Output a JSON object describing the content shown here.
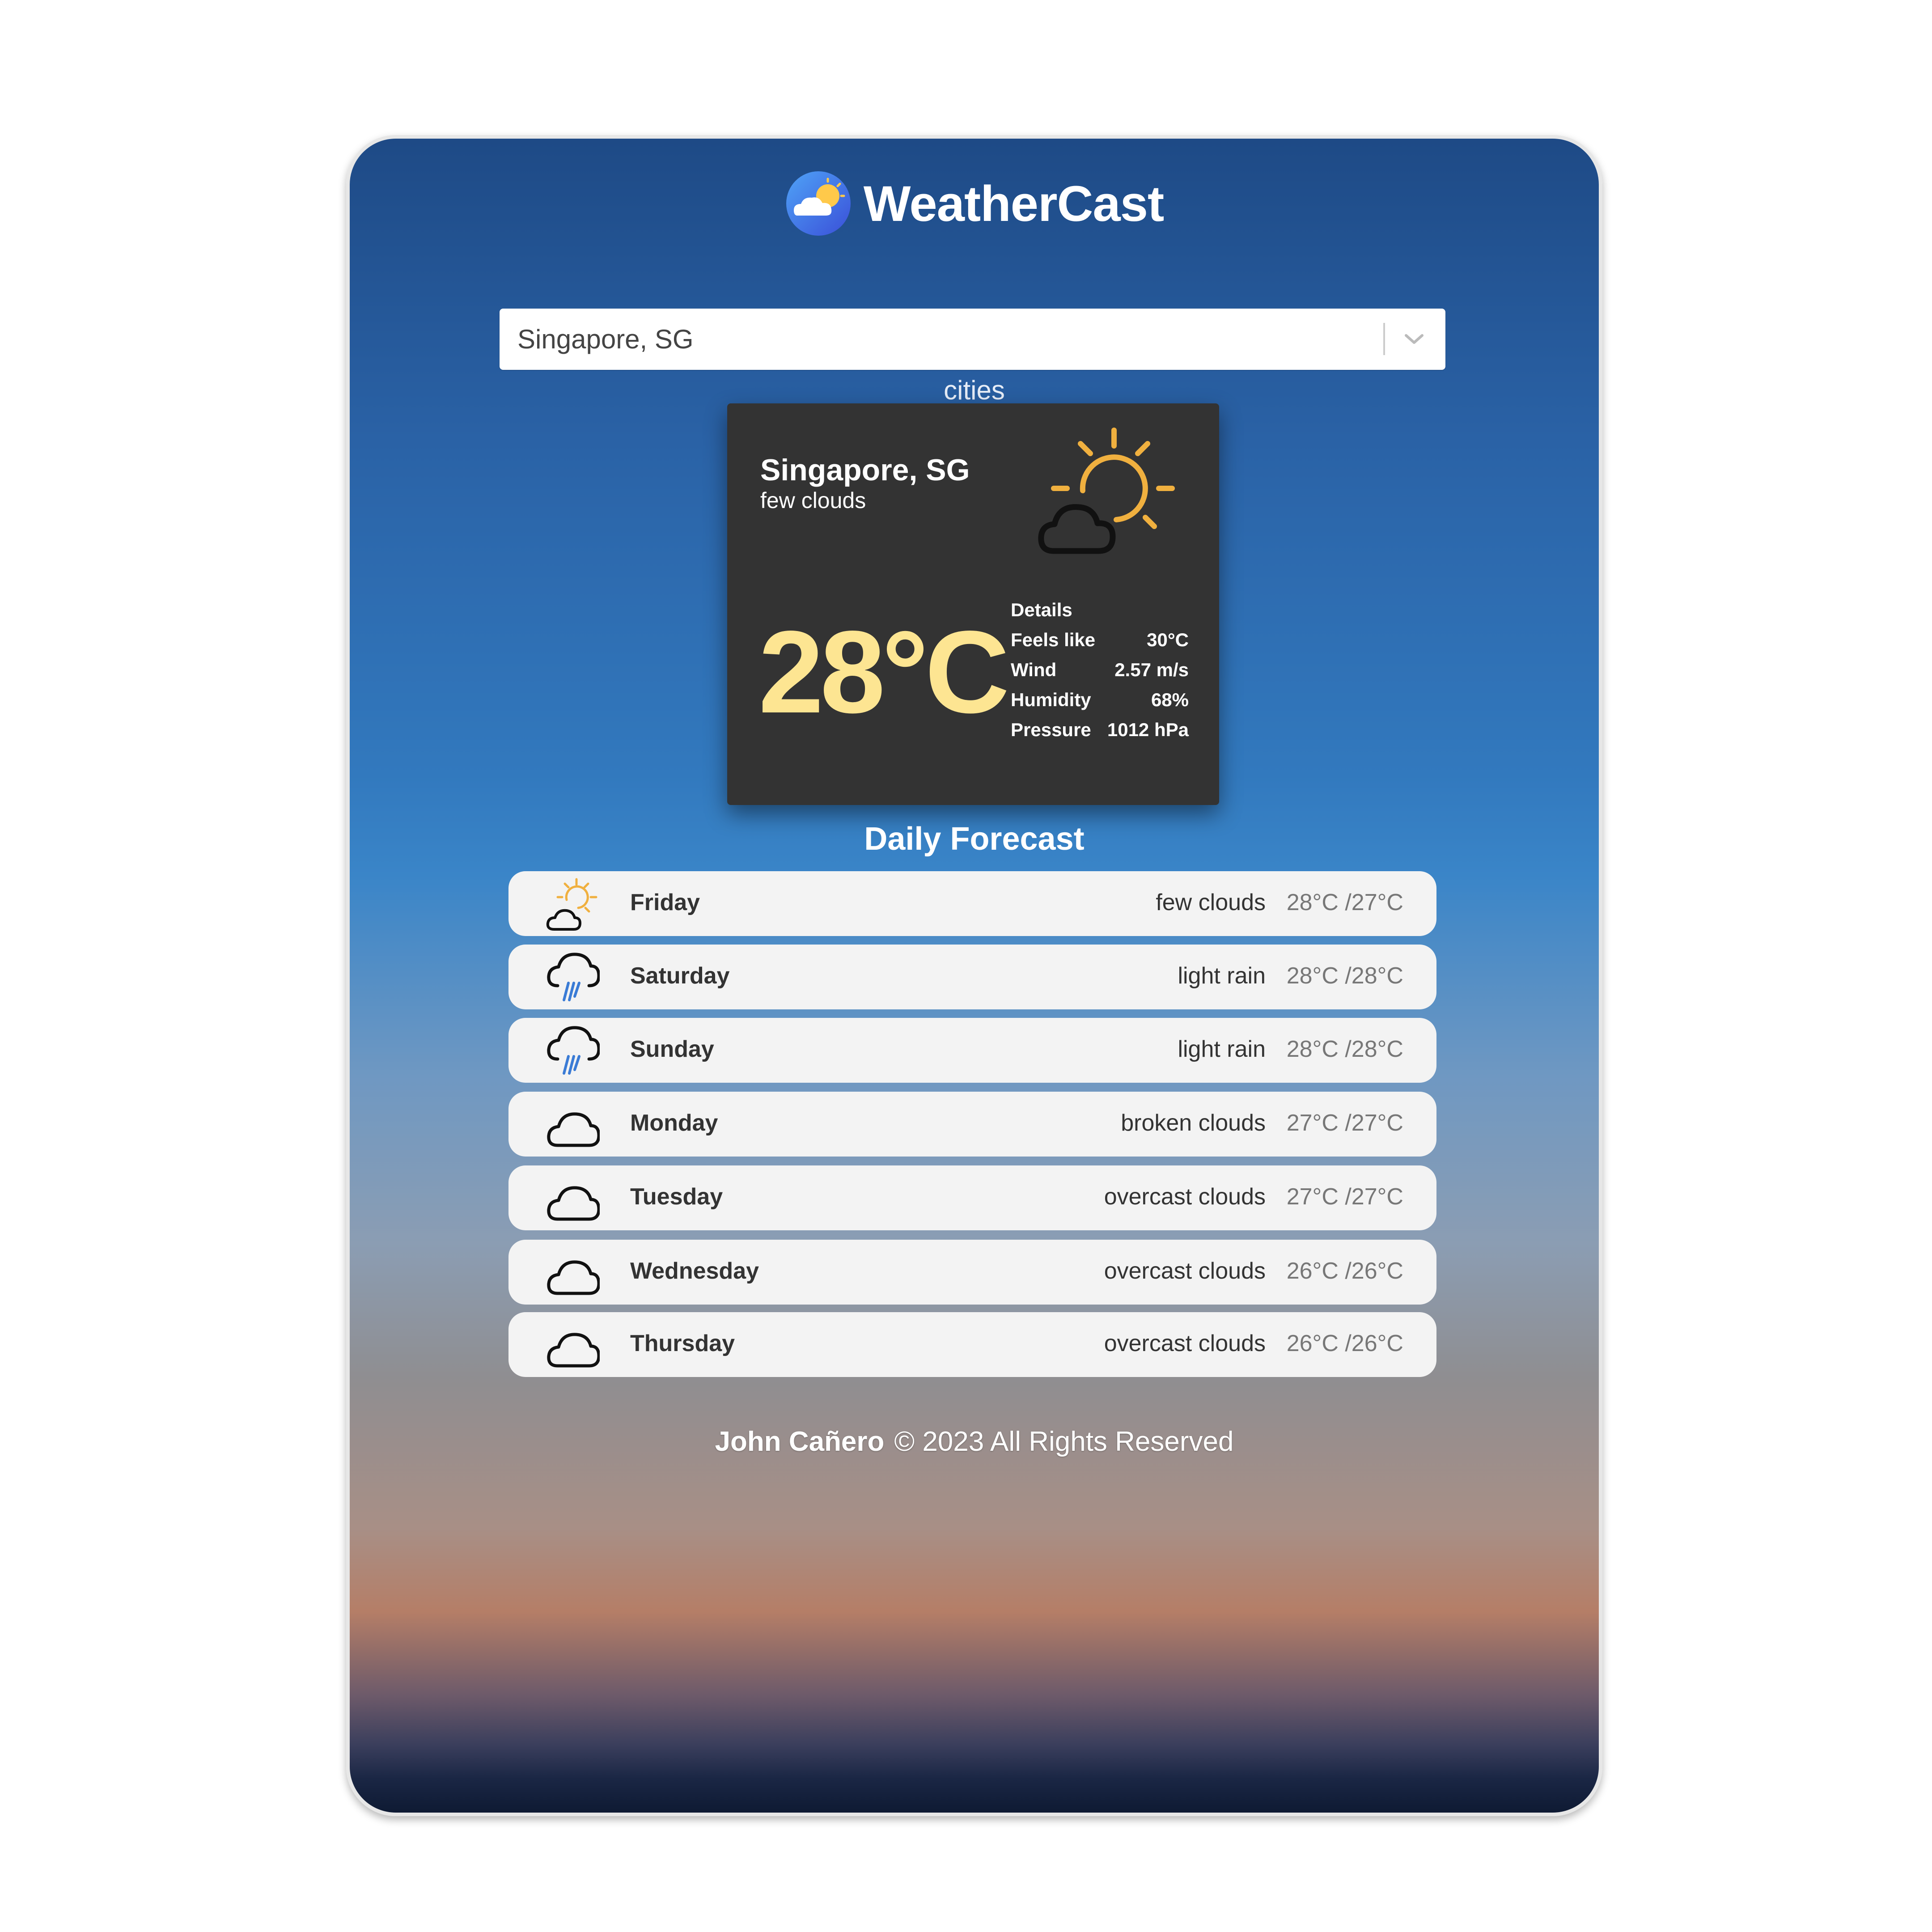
{
  "app": {
    "title": "WeatherCast",
    "subtitle": "cities",
    "logo_icon": "cloud-sun-logo-icon"
  },
  "search": {
    "selected_value": "Singapore, SG",
    "chevron_icon": "chevron-down-icon"
  },
  "current": {
    "city": "Singapore, SG",
    "description": "few clouds",
    "temperature": "28°C",
    "icon": "sun-cloud-icon",
    "details_label": "Details",
    "details": [
      {
        "label": "Feels like",
        "value": "30°C"
      },
      {
        "label": "Wind",
        "value": "2.57 m/s"
      },
      {
        "label": "Humidity",
        "value": "68%"
      },
      {
        "label": "Pressure",
        "value": "1012 hPa"
      }
    ]
  },
  "forecast": {
    "title": "Daily Forecast",
    "days": [
      {
        "day": "Friday",
        "description": "few clouds",
        "temps": "28°C /27°C",
        "icon": "sun-cloud-icon"
      },
      {
        "day": "Saturday",
        "description": "light rain",
        "temps": "28°C /28°C",
        "icon": "rain-cloud-icon"
      },
      {
        "day": "Sunday",
        "description": "light rain",
        "temps": "28°C /28°C",
        "icon": "rain-cloud-icon"
      },
      {
        "day": "Monday",
        "description": "broken clouds",
        "temps": "27°C /27°C",
        "icon": "cloud-icon"
      },
      {
        "day": "Tuesday",
        "description": "overcast clouds",
        "temps": "27°C /27°C",
        "icon": "cloud-icon"
      },
      {
        "day": "Wednesday",
        "description": "overcast clouds",
        "temps": "26°C /26°C",
        "icon": "cloud-icon"
      },
      {
        "day": "Thursday",
        "description": "overcast clouds",
        "temps": "26°C /26°C",
        "icon": "cloud-icon"
      }
    ]
  },
  "footer": {
    "author": "John Cañero",
    "copyright": "© 2023 All Rights Reserved"
  },
  "colors": {
    "accent_temp": "#fde592",
    "card_bg": "#333333",
    "row_bg": "#f3f3f3",
    "sun": "#f0b03f",
    "rain": "#3a7bd5"
  }
}
